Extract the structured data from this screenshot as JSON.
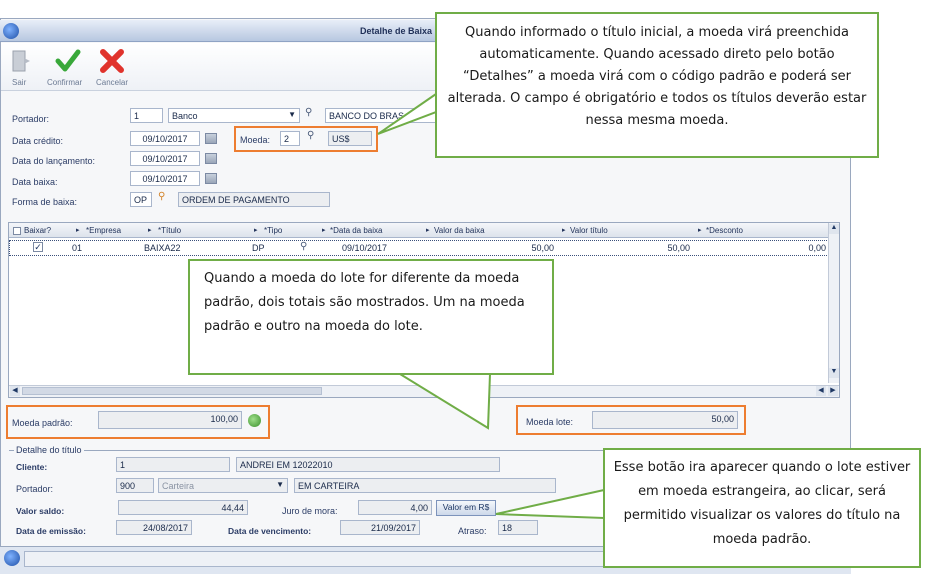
{
  "window": {
    "title": "Detalhe de Baixa"
  },
  "toolbar": {
    "exit": "Sair",
    "confirm": "Confirmar",
    "cancel": "Cancelar"
  },
  "form": {
    "portador_label": "Portador:",
    "portador_code": "1",
    "portador_type": "Banco",
    "portador_name": "BANCO DO BRAS",
    "data_credito_label": "Data crédito:",
    "data_credito": "09/10/2017",
    "data_lancamento_label": "Data do lançamento:",
    "data_lancamento": "09/10/2017",
    "data_baixa_label": "Data baixa:",
    "data_baixa": "09/10/2017",
    "forma_baixa_label": "Forma de  baixa:",
    "forma_baixa_code": "OP",
    "forma_baixa_name": "ORDEM DE PAGAMENTO",
    "moeda_label": "Moeda:",
    "moeda_code": "2",
    "moeda_name": "US$"
  },
  "grid": {
    "headers": [
      "Baixar?",
      "*Empresa",
      "*Título",
      "*Tipo",
      "*Data da baixa",
      "Valor da baixa",
      "Valor título",
      "*Desconto"
    ],
    "row": {
      "empresa": "01",
      "titulo": "BAIXA22",
      "tipo": "DP",
      "data_baixa": "09/10/2017",
      "valor_baixa": "50,00",
      "valor_titulo": "50,00",
      "desconto": "0,00"
    }
  },
  "totals": {
    "moeda_padrao_label": "Moeda padrão:",
    "moeda_padrao_value": "100,00",
    "moeda_lote_label": "Moeda lote:",
    "moeda_lote_value": "50,00"
  },
  "detalhe": {
    "section_title": "Detalhe do título",
    "cliente_label": "Cliente:",
    "cliente_code": "1",
    "cliente_name": "ANDREI EM 12022010",
    "portador_label": "Portador:",
    "portador_code": "900",
    "portador_type": "Carteira",
    "portador_name": "EM CARTEIRA",
    "valor_saldo_label": "Valor saldo:",
    "valor_saldo": "44,44",
    "juro_label": "Juro de mora:",
    "juro": "4,00",
    "valor_rs_button": "Valor em R$",
    "data_emissao_label": "Data de emissão:",
    "data_emissao": "24/08/2017",
    "data_vencimento_label": "Data de vencimento:",
    "data_vencimento": "21/09/2017",
    "atraso_label": "Atraso:",
    "atraso": "18"
  },
  "callouts": {
    "moeda": "Quando informado o título inicial, a moeda virá preenchida automaticamente. Quando acessado direto pelo botão “Detalhes” a moeda virá com o código padrão e poderá ser alterada. O campo é obrigatório e todos os títulos deverão estar nessa mesma moeda.",
    "totais": "Quando a moeda do lote for diferente da moeda padrão, dois totais são mostrados. Um na moeda padrão e outro na moeda do lote.",
    "botao": "Esse botão ira aparecer quando o lote estiver em moeda estrangeira, ao clicar, será permitido visualizar os valores do título na moeda padrão."
  },
  "colors": {
    "callout_border": "#70ad47",
    "highlight_border": "#ed7d31"
  }
}
